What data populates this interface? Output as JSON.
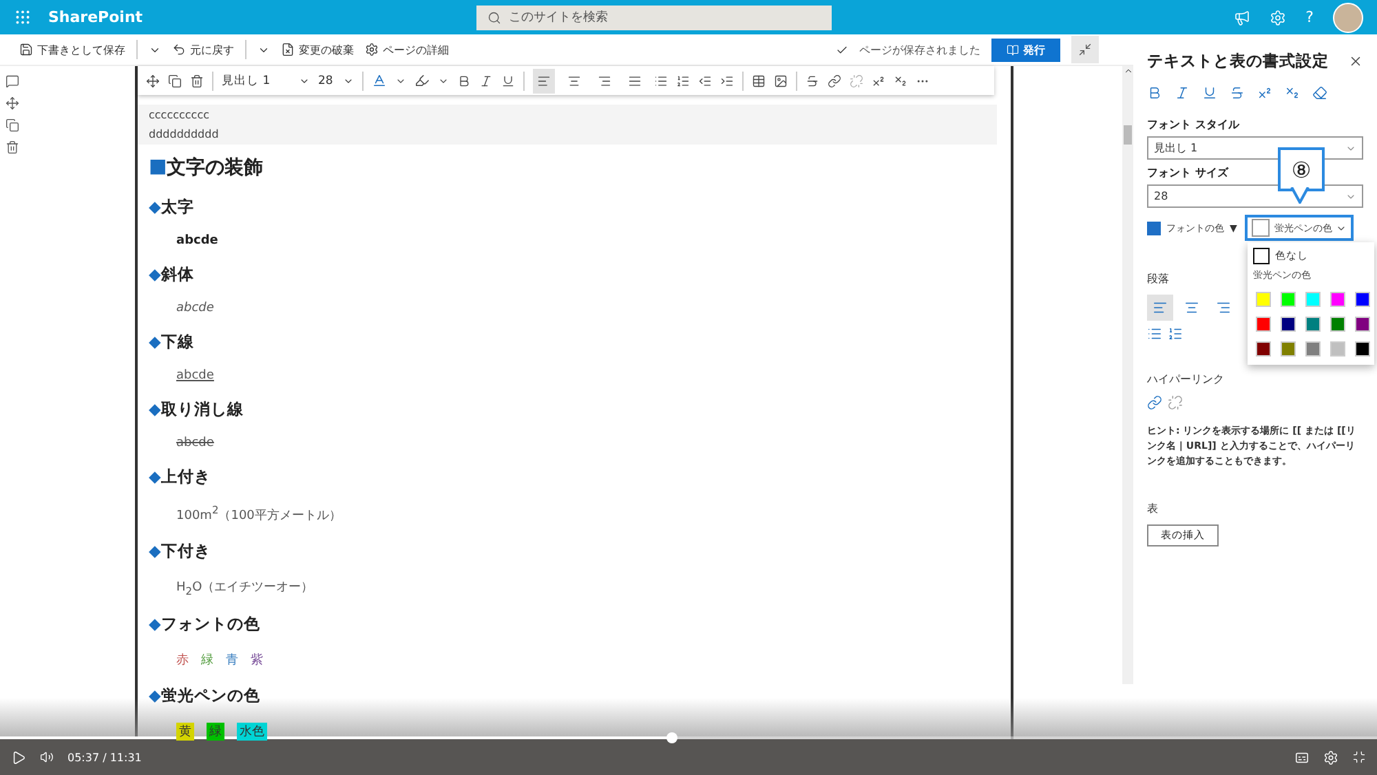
{
  "header": {
    "app_name": "SharePoint",
    "search": {
      "placeholder": "このサイトを検索"
    },
    "help": "?"
  },
  "command_bar": {
    "save_draft": "下書きとして保存",
    "undo": "元に戻す",
    "discard": "変更の破棄",
    "page_details": "ページの詳細",
    "status": "ページが保存されました",
    "publish": "発行"
  },
  "editor_toolbar": {
    "style": "見出し 1",
    "size": "28",
    "alignment": [
      {
        "selected": true
      },
      {
        "selected": false
      },
      {
        "selected": false
      },
      {
        "selected": false
      }
    ]
  },
  "content": {
    "pre_lines": [
      "cccccccccc",
      "dddddddddd"
    ],
    "heading": {
      "marker": "■",
      "title": "文字の装飾"
    },
    "sections": [
      {
        "marker": "◆",
        "title": "太字",
        "kind": "bold",
        "sample": "abcde"
      },
      {
        "marker": "◆",
        "title": "斜体",
        "kind": "italic",
        "sample": "abcde"
      },
      {
        "marker": "◆",
        "title": "下線",
        "kind": "underline",
        "sample": "abcde"
      },
      {
        "marker": "◆",
        "title": "取り消し線",
        "kind": "strike",
        "sample": "abcde"
      },
      {
        "marker": "◆",
        "title": "上付き",
        "kind": "rich",
        "sample": "100m$^{2}$（100平方メートル）"
      },
      {
        "marker": "◆",
        "title": "下付き",
        "kind": "rich",
        "sample": "H$_{2}$O（エイチツーオー）"
      },
      {
        "marker": "◆",
        "title": "フォントの色",
        "kind": "colors",
        "items": [
          {
            "text": "赤",
            "color": "#c0504d"
          },
          {
            "text": "緑",
            "color": "#4f9a3a"
          },
          {
            "text": "青",
            "color": "#3a7fc0"
          },
          {
            "text": "紫",
            "color": "#7a4f9a"
          }
        ]
      },
      {
        "marker": "◆",
        "title": "蛍光ペンの色",
        "kind": "highlights",
        "items": [
          {
            "text": "黄",
            "color": "#d4d400"
          },
          {
            "text": "緑",
            "color": "#00c000"
          },
          {
            "text": "水色",
            "color": "#00d4d4"
          }
        ]
      }
    ]
  },
  "panel": {
    "title": "テキストと表の書式設定",
    "font_style_label": "フォント スタイル",
    "font_style": "見出し 1",
    "font_size_label": "フォント サイズ",
    "font_size": "28",
    "font_color": {
      "label": "フォントの色",
      "color": "#1f6fc5",
      "caret": "▼"
    },
    "highlight": {
      "label": "蛍光ペンの色",
      "expanded": true
    },
    "highlight_menu": {
      "none": "色なし",
      "heading": "蛍光ペンの色",
      "swatches": [
        {
          "color": "#ffff00"
        },
        {
          "color": "#00ff00"
        },
        {
          "color": "#00ffff"
        },
        {
          "color": "#ff00ff"
        },
        {
          "color": "#0000ff"
        },
        {
          "color": "#ff0000"
        },
        {
          "color": "#000080"
        },
        {
          "color": "#008080"
        },
        {
          "color": "#008000"
        },
        {
          "color": "#800080"
        },
        {
          "color": "#800000"
        },
        {
          "color": "#808000"
        },
        {
          "color": "#808080"
        },
        {
          "color": "#c0c0c0"
        },
        {
          "color": "#000000"
        }
      ]
    },
    "paragraph_label": "段落",
    "alignment": [
      {
        "selected": true
      },
      {
        "selected": false
      },
      {
        "selected": false
      }
    ],
    "hyperlink_label": "ハイパーリンク",
    "hint": "ヒント: リンクを表示する場所に [[ または [[リンク名 | URL]] と入力することで、ハイパーリンクを追加することもできます。",
    "table_label": "表",
    "insert_table": "表の挿入"
  },
  "callout": {
    "text": "⑧"
  },
  "player": {
    "time": "05:37 / 11:31",
    "level": 0.488
  }
}
